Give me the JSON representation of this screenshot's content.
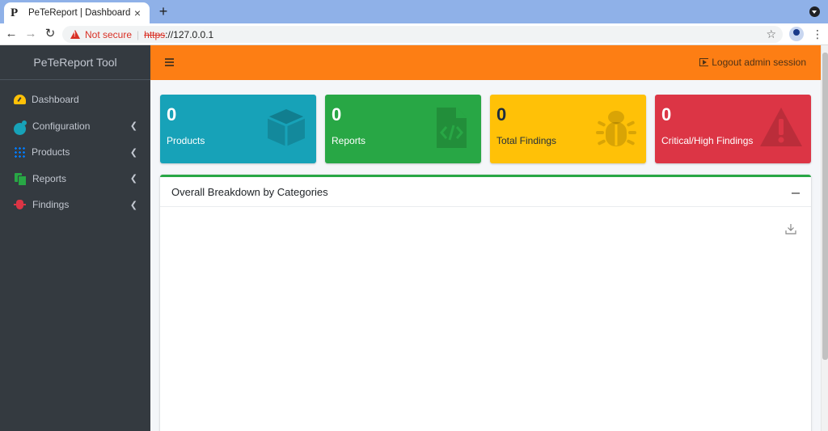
{
  "browser": {
    "tab_title": "PeTeReport | Dashboard",
    "favicon": "P",
    "new_tab": "+",
    "close": "×",
    "security_label": "Not secure",
    "url_scheme": "https",
    "url_rest": "://127.0.0.1"
  },
  "sidebar": {
    "brand": "PeTeReport Tool",
    "items": [
      {
        "label": "Dashboard",
        "icon": "tachometer-icon",
        "color": "#ffc107",
        "has_submenu": false
      },
      {
        "label": "Configuration",
        "icon": "cogs-icon",
        "color": "#17a2b8",
        "has_submenu": true
      },
      {
        "label": "Products",
        "icon": "grid-icon",
        "color": "#007bff",
        "has_submenu": true
      },
      {
        "label": "Reports",
        "icon": "copy-icon",
        "color": "#28a745",
        "has_submenu": true
      },
      {
        "label": "Findings",
        "icon": "bug-icon",
        "color": "#dc3545",
        "has_submenu": true
      }
    ]
  },
  "topbar": {
    "logout_label": "Logout admin session",
    "color": "#fd7e14"
  },
  "stats": [
    {
      "count": "0",
      "label": "Products",
      "icon": "cube-icon",
      "color": "#17a2b8"
    },
    {
      "count": "0",
      "label": "Reports",
      "icon": "file-code-icon",
      "color": "#28a745"
    },
    {
      "count": "0",
      "label": "Total Findings",
      "icon": "bug-icon",
      "color": "#ffc107"
    },
    {
      "count": "0",
      "label": "Critical/High Findings",
      "icon": "exclamation-triangle-icon",
      "color": "#dc3545"
    }
  ],
  "card": {
    "title": "Overall Breakdown by Categories",
    "border_color": "#28a745"
  }
}
